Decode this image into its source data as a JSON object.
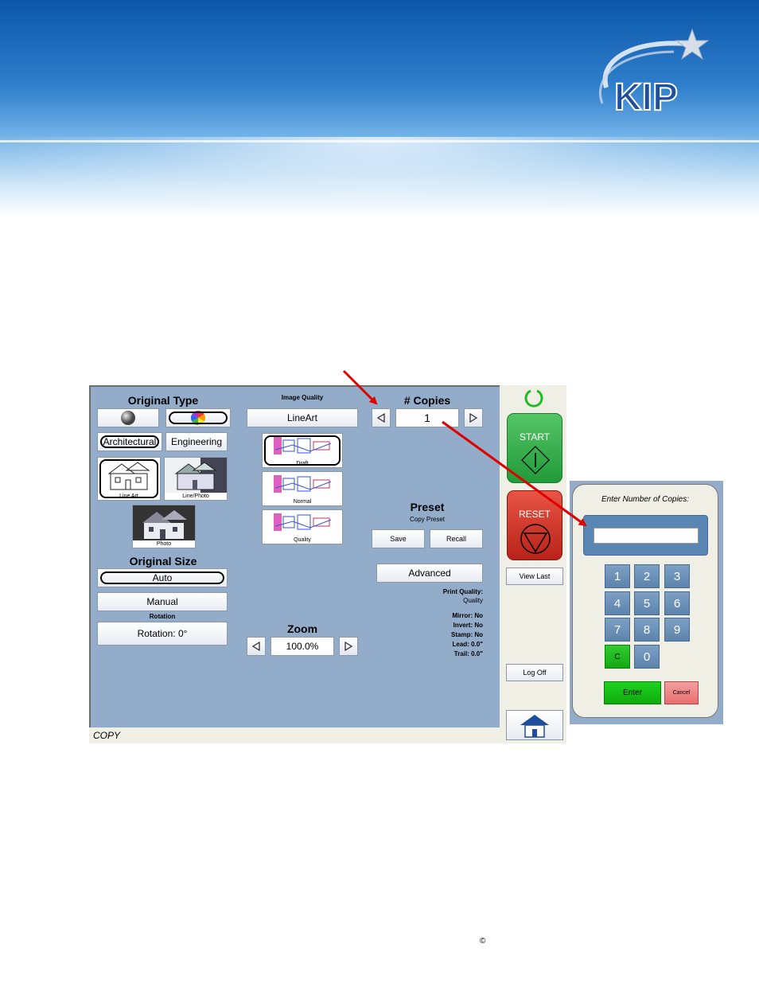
{
  "screen": {
    "original_type": {
      "heading": "Original Type",
      "mode_architectural": "Architectural",
      "mode_engineering": "Engineering",
      "thumb_lineart": "Line Art",
      "thumb_linephoto": "Line/Photo",
      "thumb_photo": "Photo"
    },
    "original_size": {
      "heading": "Original Size",
      "auto": "Auto",
      "manual": "Manual",
      "rotation_caption": "Rotation",
      "rotation_button": "Rotation: 0°"
    },
    "image_quality": {
      "heading": "Image Quality",
      "mode_button": "LineArt",
      "draft": "Draft",
      "normal": "Normal",
      "quality": "Quality"
    },
    "zoom": {
      "heading": "Zoom",
      "value": "100.0%"
    },
    "copies": {
      "heading": "# Copies",
      "value": "1"
    },
    "preset": {
      "heading": "Preset",
      "subheading": "Copy Preset",
      "save": "Save",
      "recall": "Recall"
    },
    "advanced": "Advanced",
    "info": {
      "print_quality_label": "Print Quality:",
      "print_quality_value": "Quality",
      "mirror": "Mirror: No",
      "invert": "Invert: No",
      "stamp": "Stamp: No",
      "lead": "Lead: 0.0\"",
      "trail": "Trail: 0.0\""
    },
    "status": "COPY"
  },
  "controls": {
    "start": "START",
    "reset": "RESET",
    "view_last": "View Last",
    "log_off": "Log Off"
  },
  "numpad": {
    "title": "Enter Number of Copies:",
    "input_value": "",
    "keys": [
      "1",
      "2",
      "3",
      "4",
      "5",
      "6",
      "7",
      "8",
      "9",
      "C",
      "0"
    ],
    "enter": "Enter",
    "cancel": "Cancel"
  },
  "footer": {
    "copyright": "©"
  },
  "colors": {
    "banner_top": "#0b56a8",
    "screen_bg": "#93acc9",
    "start_green": "#2fa84a",
    "reset_red": "#c8322a",
    "annotation_arrow": "#e00000"
  }
}
